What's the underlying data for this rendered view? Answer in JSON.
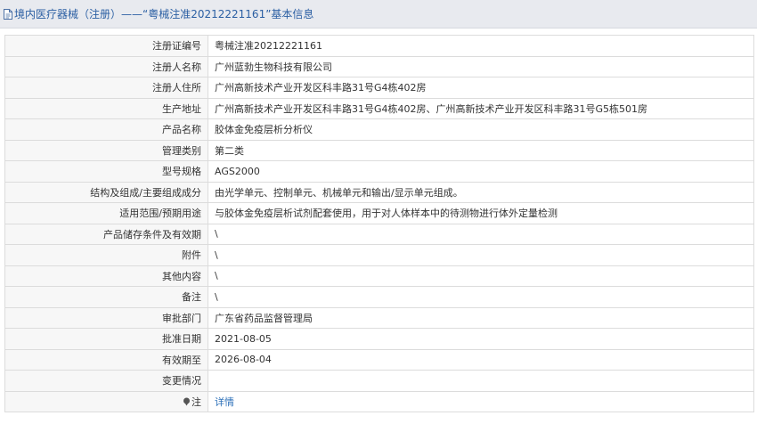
{
  "header": {
    "title": "境内医疗器械（注册）——“粤械注准20212221161”基本信息",
    "icon": "document-icon"
  },
  "rows": [
    {
      "label": "注册证编号",
      "value": "粤械注准20212221161"
    },
    {
      "label": "注册人名称",
      "value": "广州蓝勃生物科技有限公司"
    },
    {
      "label": "注册人住所",
      "value": "广州高新技术产业开发区科丰路31号G4栋402房"
    },
    {
      "label": "生产地址",
      "value": "广州高新技术产业开发区科丰路31号G4栋402房、广州高新技术产业开发区科丰路31号G5栋501房"
    },
    {
      "label": "产品名称",
      "value": "胶体金免疫层析分析仪"
    },
    {
      "label": "管理类别",
      "value": "第二类"
    },
    {
      "label": "型号规格",
      "value": "AGS2000"
    },
    {
      "label": "结构及组成/主要组成成分",
      "value": "由光学单元、控制单元、机械单元和输出/显示单元组成。"
    },
    {
      "label": "适用范围/预期用途",
      "value": "与胶体金免疫层析试剂配套使用，用于对人体样本中的待测物进行体外定量检测"
    },
    {
      "label": "产品储存条件及有效期",
      "value": "\\"
    },
    {
      "label": "附件",
      "value": "\\"
    },
    {
      "label": "其他内容",
      "value": "\\"
    },
    {
      "label": "备注",
      "value": "\\"
    },
    {
      "label": "审批部门",
      "value": "广东省药品监督管理局"
    },
    {
      "label": "批准日期",
      "value": "2021-08-05"
    },
    {
      "label": "有效期至",
      "value": "2026-08-04"
    },
    {
      "label": "变更情况",
      "value": ""
    }
  ],
  "note": {
    "label": "注",
    "icon": "info-icon",
    "link": "详情"
  },
  "colors": {
    "accent": "#2b5fa3",
    "link": "#2b6fb8",
    "header_bg": "#e8eaef",
    "label_bg": "#f7f7f7",
    "border": "#dcdcdc"
  }
}
